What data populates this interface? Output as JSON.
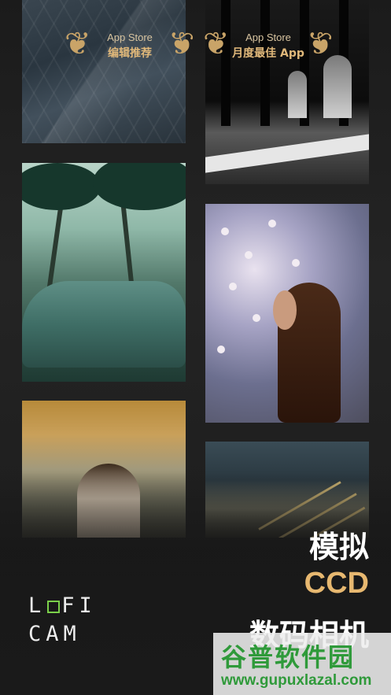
{
  "awards": [
    {
      "store": "App Store",
      "title": "编辑推荐"
    },
    {
      "store": "App Store",
      "title": "月度最佳 App"
    }
  ],
  "gallery": [
    {
      "subject": "glass-building-photo"
    },
    {
      "subject": "black-white-arcade-photo"
    },
    {
      "subject": "convertible-palm-trees-photo"
    },
    {
      "subject": "woman-cherry-blossom-photo"
    },
    {
      "subject": "woman-autumn-tree-photo"
    },
    {
      "subject": "city-traffic-photo"
    }
  ],
  "logo": {
    "line1_a": "L",
    "line1_b": "FI",
    "line2": "CAM"
  },
  "tagline": {
    "line1": "模拟",
    "line2": "CCD",
    "line3": "数码相机"
  },
  "watermark": {
    "brand": "谷普软件园",
    "url": "www.gupuxlazal.com"
  },
  "colors": {
    "accent_gold": "#e7b870",
    "logo_green": "#7bd04a",
    "watermark_green": "#2f9a3a"
  }
}
